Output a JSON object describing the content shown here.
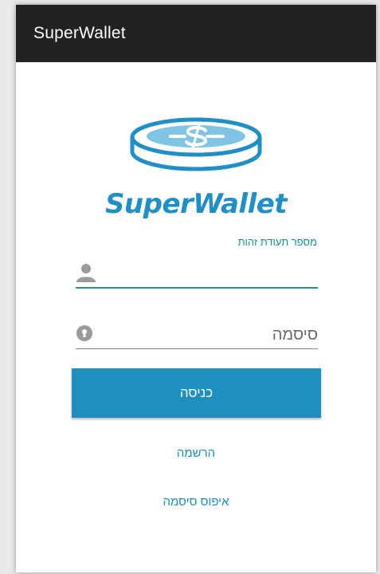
{
  "appbar": {
    "title": "SuperWallet"
  },
  "logo": {
    "icon": "coin-dollar-icon",
    "text": "SuperWallet",
    "color": "#1f8fc5"
  },
  "form": {
    "id_label": "מספר תעודת זהות",
    "id_value": "",
    "id_icon": "person-icon",
    "password_placeholder": "סיסמה",
    "password_icon": "lock-icon"
  },
  "actions": {
    "login_label": "כניסה",
    "register_label": "הרשמה",
    "reset_label": "איפוס סיסמה"
  },
  "colors": {
    "appbar": "#222222",
    "accent_teal": "#1a9a95",
    "button": "#1e8fbf",
    "link": "#1a8fbf"
  }
}
